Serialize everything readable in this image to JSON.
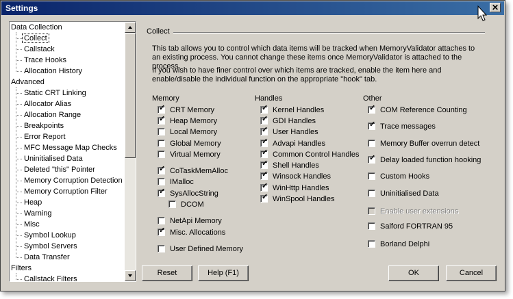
{
  "window": {
    "title": "Settings",
    "close_glyph": "✕"
  },
  "tree": {
    "items": [
      {
        "label": "Data Collection",
        "level": 0
      },
      {
        "label": "Collect",
        "level": 1,
        "selected": true
      },
      {
        "label": "Callstack",
        "level": 1
      },
      {
        "label": "Trace Hooks",
        "level": 1
      },
      {
        "label": "Allocation History",
        "level": 1
      },
      {
        "label": "Advanced",
        "level": 0
      },
      {
        "label": "Static CRT Linking",
        "level": 1
      },
      {
        "label": "Allocator Alias",
        "level": 1
      },
      {
        "label": "Allocation Range",
        "level": 1
      },
      {
        "label": "Breakpoints",
        "level": 1
      },
      {
        "label": "Error Report",
        "level": 1
      },
      {
        "label": "MFC Message Map Checks",
        "level": 1
      },
      {
        "label": "Uninitialised Data",
        "level": 1
      },
      {
        "label": "Deleted \"this\" Pointer",
        "level": 1
      },
      {
        "label": "Memory Corruption Detection",
        "level": 1
      },
      {
        "label": "Memory Corruption Filter",
        "level": 1
      },
      {
        "label": "Heap",
        "level": 1
      },
      {
        "label": "Warning",
        "level": 1
      },
      {
        "label": "Misc",
        "level": 1
      },
      {
        "label": "Symbol Lookup",
        "level": 1
      },
      {
        "label": "Symbol Servers",
        "level": 1
      },
      {
        "label": "Data Transfer",
        "level": 1
      },
      {
        "label": "Filters",
        "level": 0
      },
      {
        "label": "Callstack Filters",
        "level": 1
      }
    ]
  },
  "panel": {
    "header": "Collect",
    "desc1": "This tab allows you to control which data items will be tracked when MemoryValidator attaches to an existing process. You cannot change these items once MemoryValidator is attached to the process.",
    "desc2": "If you wish to have finer control over which items are tracked, enable the item here and enable/disable the individual function on the appropriate \"hook\" tab."
  },
  "memory": {
    "title": "Memory",
    "items": [
      {
        "label": "CRT Memory",
        "checked": true
      },
      {
        "label": "Heap Memory",
        "checked": true
      },
      {
        "label": "Local Memory",
        "checked": false
      },
      {
        "label": "Global Memory",
        "checked": false
      },
      {
        "label": "Virtual Memory",
        "checked": false
      },
      {
        "label": "CoTaskMemAlloc",
        "checked": true
      },
      {
        "label": "IMalloc",
        "checked": false
      },
      {
        "label": "SysAllocString",
        "checked": true
      },
      {
        "label": "DCOM",
        "checked": false
      },
      {
        "label": "NetApi Memory",
        "checked": false
      },
      {
        "label": "Misc. Allocations",
        "checked": true
      },
      {
        "label": "User Defined Memory",
        "checked": false
      }
    ]
  },
  "handles": {
    "title": "Handles",
    "items": [
      {
        "label": "Kernel Handles",
        "checked": true
      },
      {
        "label": "GDI Handles",
        "checked": true
      },
      {
        "label": "User Handles",
        "checked": true
      },
      {
        "label": "Advapi Handles",
        "checked": true
      },
      {
        "label": "Common Control Handles",
        "checked": true
      },
      {
        "label": "Shell Handles",
        "checked": true
      },
      {
        "label": "Winsock Handles",
        "checked": true
      },
      {
        "label": "WinHttp Handles",
        "checked": true
      },
      {
        "label": "WinSpool Handles",
        "checked": true
      }
    ]
  },
  "other": {
    "title": "Other",
    "items": [
      {
        "label": "COM Reference Counting",
        "checked": true
      },
      {
        "label": "Trace messages",
        "checked": true
      },
      {
        "label": "Memory Buffer overrun detect",
        "checked": false
      },
      {
        "label": "Delay loaded function hooking",
        "checked": true
      },
      {
        "label": "Custom Hooks",
        "checked": false
      },
      {
        "label": "Uninitialised Data",
        "checked": false
      },
      {
        "label": "Enable user extensions",
        "checked": false,
        "disabled": true
      },
      {
        "label": "Salford FORTRAN 95",
        "checked": false
      },
      {
        "label": "Borland Delphi",
        "checked": false
      }
    ]
  },
  "buttons": {
    "reset": "Reset",
    "help": "Help (F1)",
    "ok": "OK",
    "cancel": "Cancel"
  },
  "check_glyph": "✓",
  "colors": {
    "title_start": "#0a246a",
    "title_end": "#3a6ea5",
    "face": "#d4d0c8"
  }
}
